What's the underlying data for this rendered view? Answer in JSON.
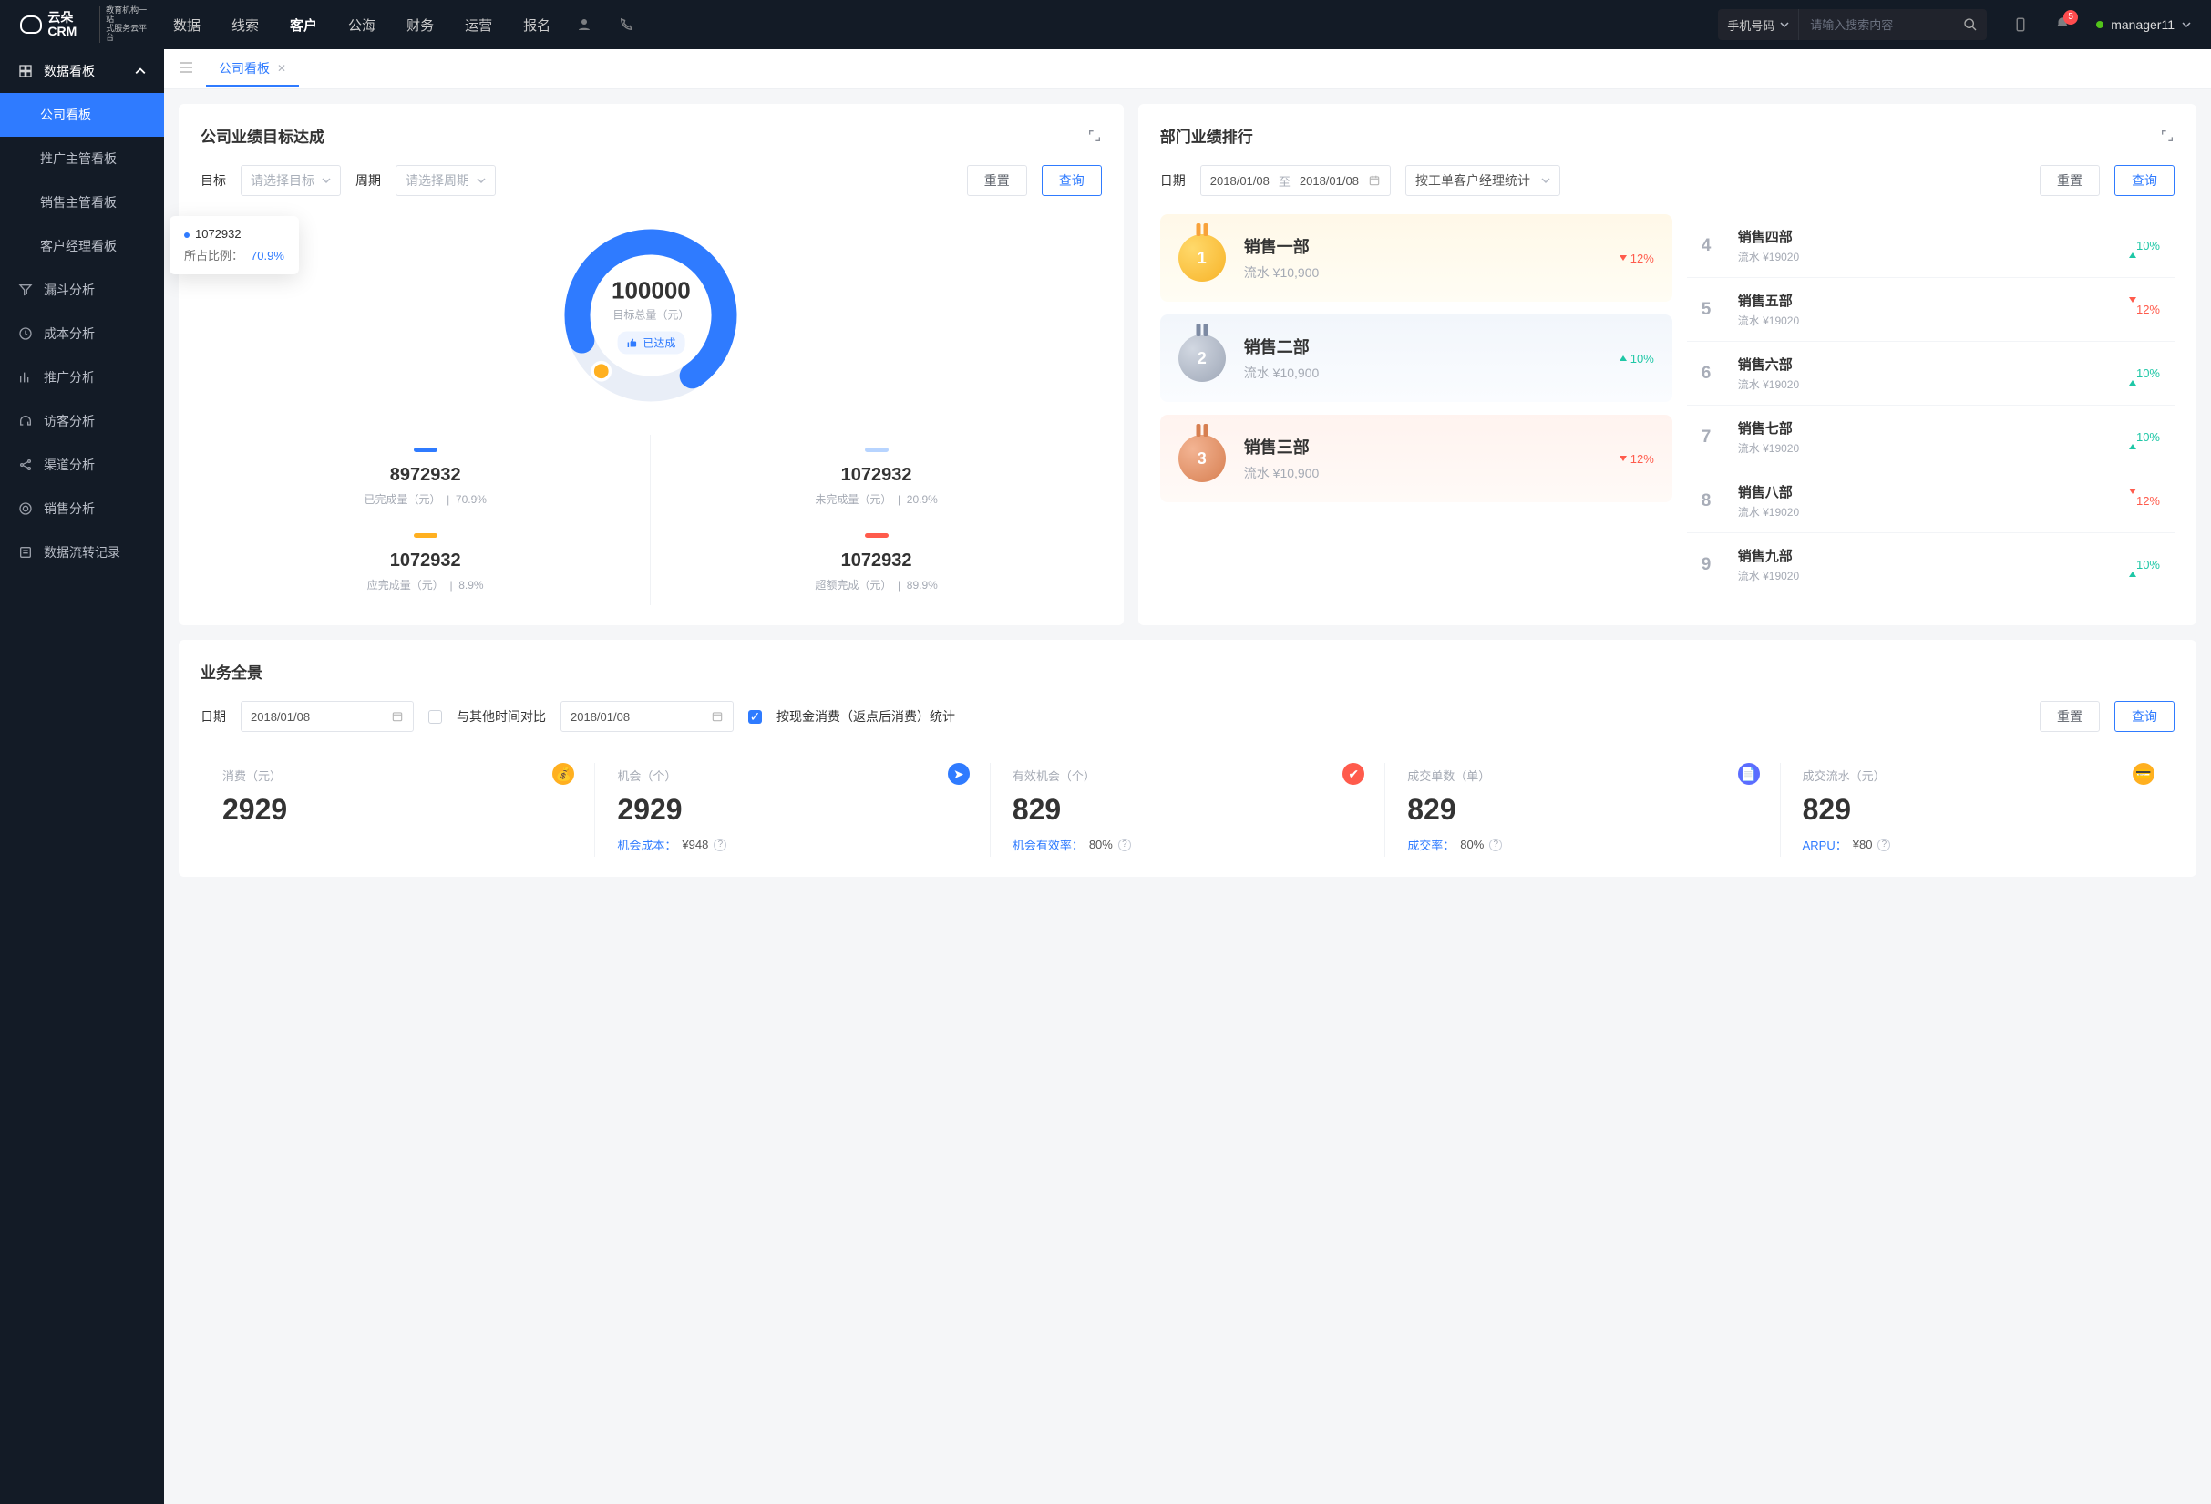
{
  "brand": {
    "name": "云朵CRM",
    "tagline1": "教育机构一站",
    "tagline2": "式服务云平台"
  },
  "topnav": {
    "items": [
      "数据",
      "线索",
      "客户",
      "公海",
      "财务",
      "运营",
      "报名"
    ],
    "active_index": 2
  },
  "search": {
    "type_label": "手机号码",
    "placeholder": "请输入搜索内容"
  },
  "notif_count": "5",
  "user": {
    "name": "manager11"
  },
  "sidebar": {
    "group": "数据看板",
    "items": [
      "公司看板",
      "推广主管看板",
      "销售主管看板",
      "客户经理看板"
    ],
    "active_index": 0,
    "others": [
      "漏斗分析",
      "成本分析",
      "推广分析",
      "访客分析",
      "渠道分析",
      "销售分析",
      "数据流转记录"
    ]
  },
  "tab": {
    "label": "公司看板"
  },
  "panel1": {
    "title": "公司业绩目标达成",
    "target_label": "目标",
    "target_placeholder": "请选择目标",
    "period_label": "周期",
    "period_placeholder": "请选择周期",
    "reset": "重置",
    "query": "查询",
    "ring": {
      "total": "100000",
      "total_label": "目标总量（元）",
      "achieved_tag": "已达成"
    },
    "tooltip": {
      "value": "1072932",
      "ratio_label": "所占比例：",
      "ratio": "70.9%"
    },
    "stats": [
      {
        "bar": "c-blue",
        "value": "8972932",
        "label": "已完成量（元）",
        "pct": "70.9%"
      },
      {
        "bar": "c-lblue",
        "value": "1072932",
        "label": "未完成量（元）",
        "pct": "20.9%"
      },
      {
        "bar": "c-orange",
        "value": "1072932",
        "label": "应完成量（元）",
        "pct": "8.9%"
      },
      {
        "bar": "c-red",
        "value": "1072932",
        "label": "超额完成（元）",
        "pct": "89.9%"
      }
    ]
  },
  "panel2": {
    "title": "部门业绩排行",
    "date_label": "日期",
    "date_from": "2018/01/08",
    "date_mid": "至",
    "date_to": "2018/01/08",
    "grouping": "按工单客户经理统计",
    "reset": "重置",
    "query": "查询",
    "top": [
      {
        "name": "销售一部",
        "flow": "流水 ¥10,900",
        "pct": "12%",
        "dir": "down"
      },
      {
        "name": "销售二部",
        "flow": "流水 ¥10,900",
        "pct": "10%",
        "dir": "up"
      },
      {
        "name": "销售三部",
        "flow": "流水 ¥10,900",
        "pct": "12%",
        "dir": "down"
      }
    ],
    "rest": [
      {
        "rank": "4",
        "name": "销售四部",
        "flow": "流水 ¥19020",
        "pct": "10%",
        "dir": "up"
      },
      {
        "rank": "5",
        "name": "销售五部",
        "flow": "流水 ¥19020",
        "pct": "12%",
        "dir": "down"
      },
      {
        "rank": "6",
        "name": "销售六部",
        "flow": "流水 ¥19020",
        "pct": "10%",
        "dir": "up"
      },
      {
        "rank": "7",
        "name": "销售七部",
        "flow": "流水 ¥19020",
        "pct": "10%",
        "dir": "up"
      },
      {
        "rank": "8",
        "name": "销售八部",
        "flow": "流水 ¥19020",
        "pct": "12%",
        "dir": "down"
      },
      {
        "rank": "9",
        "name": "销售九部",
        "flow": "流水 ¥19020",
        "pct": "10%",
        "dir": "up"
      }
    ]
  },
  "panel3": {
    "title": "业务全景",
    "date_label": "日期",
    "date": "2018/01/08",
    "compare_label": "与其他时间对比",
    "compare_date": "2018/01/08",
    "checkbox_label": "按现金消费（返点后消费）统计",
    "reset": "重置",
    "query": "查询",
    "kpis": [
      {
        "title": "消费（元）",
        "value": "2929",
        "sub_label": "",
        "sub_value": "",
        "icon": "i1",
        "glyph": "💰"
      },
      {
        "title": "机会（个）",
        "value": "2929",
        "sub_label": "机会成本：",
        "sub_value": "¥948",
        "icon": "i2",
        "glyph": "➤"
      },
      {
        "title": "有效机会（个）",
        "value": "829",
        "sub_label": "机会有效率：",
        "sub_value": "80%",
        "icon": "i3",
        "glyph": "✔"
      },
      {
        "title": "成交单数（单）",
        "value": "829",
        "sub_label": "成交率：",
        "sub_value": "80%",
        "icon": "i4",
        "glyph": "📄"
      },
      {
        "title": "成交流水（元）",
        "value": "829",
        "sub_label": "ARPU：",
        "sub_value": "¥80",
        "icon": "i5",
        "glyph": "💳"
      }
    ]
  },
  "chart_data": {
    "type": "pie",
    "title": "目标总量（元） 100000",
    "series": [
      {
        "name": "已完成量",
        "value": 8972932,
        "pct": 70.9,
        "color": "#2f7bff"
      },
      {
        "name": "未完成量",
        "value": 1072932,
        "pct": 20.9,
        "color": "#b7d4ff"
      },
      {
        "name": "应完成量",
        "value": 1072932,
        "pct": 8.9,
        "color": "#ffb020"
      },
      {
        "name": "超额完成",
        "value": 1072932,
        "pct": 89.9,
        "color": "#ff5b4c"
      }
    ],
    "center_value": 100000,
    "center_label": "目标总量（元）",
    "highlight": {
      "value": 1072932,
      "pct": 70.9
    }
  }
}
